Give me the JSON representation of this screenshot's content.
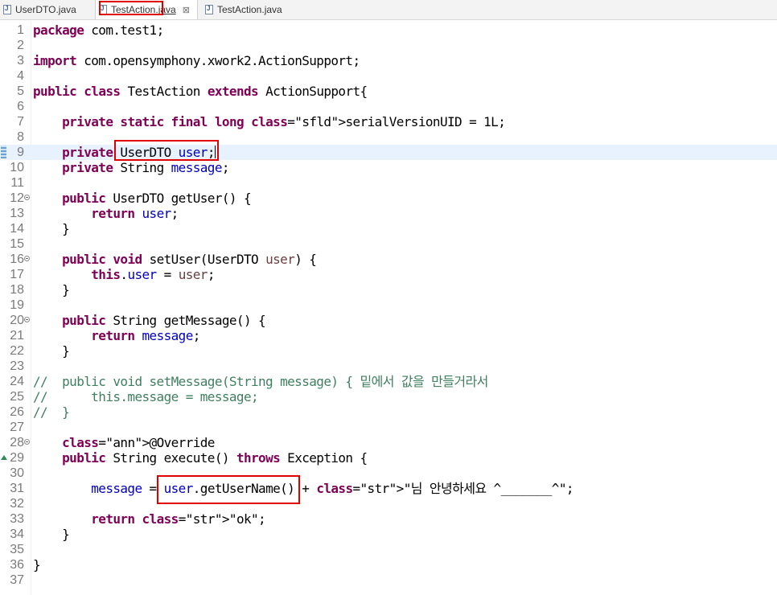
{
  "tabs": [
    {
      "label": "UserDTO.java",
      "active": false
    },
    {
      "label": "TestAction.java",
      "active": true
    },
    {
      "label": "TestAction.java",
      "active": false
    }
  ],
  "lines": [
    "package com.test1;",
    "",
    "import com.opensymphony.xwork2.ActionSupport;",
    "",
    "public class TestAction extends ActionSupport{",
    "",
    "    private static final long serialVersionUID = 1L;",
    "",
    "    private UserDTO user;",
    "    private String message;",
    "",
    "    public UserDTO getUser() {",
    "        return user;",
    "    }",
    "",
    "    public void setUser(UserDTO user) {",
    "        this.user = user;",
    "    }",
    "",
    "    public String getMessage() {",
    "        return message;",
    "    }",
    "",
    "//  public void setMessage(String message) { 밑에서 값을 만들거라서",
    "//      this.message = message;",
    "//  }",
    "",
    "    @Override",
    "    public String execute() throws Exception {",
    "",
    "        message = user.getUserName() + \"님 안녕하세요 ^_______^\";",
    "",
    "        return \"ok\";",
    "    }",
    "",
    "}",
    ""
  ],
  "line_numbers": [
    "1",
    "2",
    "3",
    "4",
    "5",
    "6",
    "7",
    "8",
    "9",
    "10",
    "11",
    "12",
    "13",
    "14",
    "15",
    "16",
    "17",
    "18",
    "19",
    "20",
    "21",
    "22",
    "23",
    "24",
    "25",
    "26",
    "27",
    "28",
    "29",
    "30",
    "31",
    "32",
    "33",
    "34",
    "35",
    "36",
    "37"
  ],
  "current_line": 9,
  "fold_lines": [
    12,
    16,
    20,
    28
  ],
  "override_line": 29,
  "bookmark_line": 9,
  "colors": {
    "keyword": "#7f0055",
    "field": "#0000c0",
    "parameter": "#6a3e3e",
    "string": "#2a00ff",
    "comment": "#3f7f5f",
    "annotation": "#646464",
    "highlight_box": "#e00000",
    "current_line_bg": "#e8f2fe"
  }
}
